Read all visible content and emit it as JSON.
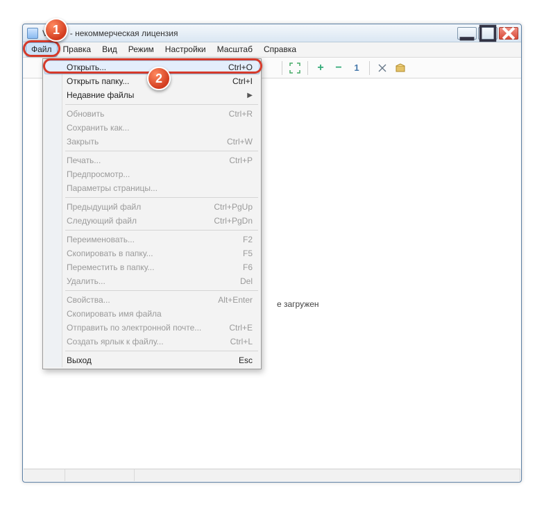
{
  "title": "Viewer - некоммерческая лицензия",
  "menubar": [
    "Файл",
    "Правка",
    "Вид",
    "Режим",
    "Настройки",
    "Масштаб",
    "Справка"
  ],
  "content_message": "е загружен",
  "callouts": {
    "b1": "1",
    "b2": "2"
  },
  "dropdown": {
    "groups": [
      [
        {
          "label": "Открыть...",
          "accel": "Ctrl+O",
          "hl": true
        },
        {
          "label": "Открыть папку...",
          "accel": "Ctrl+I"
        },
        {
          "label": "Недавние файлы",
          "submenu": true
        }
      ],
      [
        {
          "label": "Обновить",
          "accel": "Ctrl+R",
          "disabled": true
        },
        {
          "label": "Сохранить как...",
          "disabled": true
        },
        {
          "label": "Закрыть",
          "accel": "Ctrl+W",
          "disabled": true
        }
      ],
      [
        {
          "label": "Печать...",
          "accel": "Ctrl+P",
          "disabled": true
        },
        {
          "label": "Предпросмотр...",
          "disabled": true
        },
        {
          "label": "Параметры страницы...",
          "disabled": true
        }
      ],
      [
        {
          "label": "Предыдущий файл",
          "accel": "Ctrl+PgUp",
          "disabled": true
        },
        {
          "label": "Следующий файл",
          "accel": "Ctrl+PgDn",
          "disabled": true
        }
      ],
      [
        {
          "label": "Переименовать...",
          "accel": "F2",
          "disabled": true
        },
        {
          "label": "Скопировать в папку...",
          "accel": "F5",
          "disabled": true
        },
        {
          "label": "Переместить в папку...",
          "accel": "F6",
          "disabled": true
        },
        {
          "label": "Удалить...",
          "accel": "Del",
          "disabled": true
        }
      ],
      [
        {
          "label": "Свойства...",
          "accel": "Alt+Enter",
          "disabled": true
        },
        {
          "label": "Скопировать имя файла",
          "disabled": true
        },
        {
          "label": "Отправить по электронной почте...",
          "accel": "Ctrl+E",
          "disabled": true
        },
        {
          "label": "Создать ярлык к файлу...",
          "accel": "Ctrl+L",
          "disabled": true
        }
      ],
      [
        {
          "label": "Выход",
          "accel": "Esc"
        }
      ]
    ]
  }
}
